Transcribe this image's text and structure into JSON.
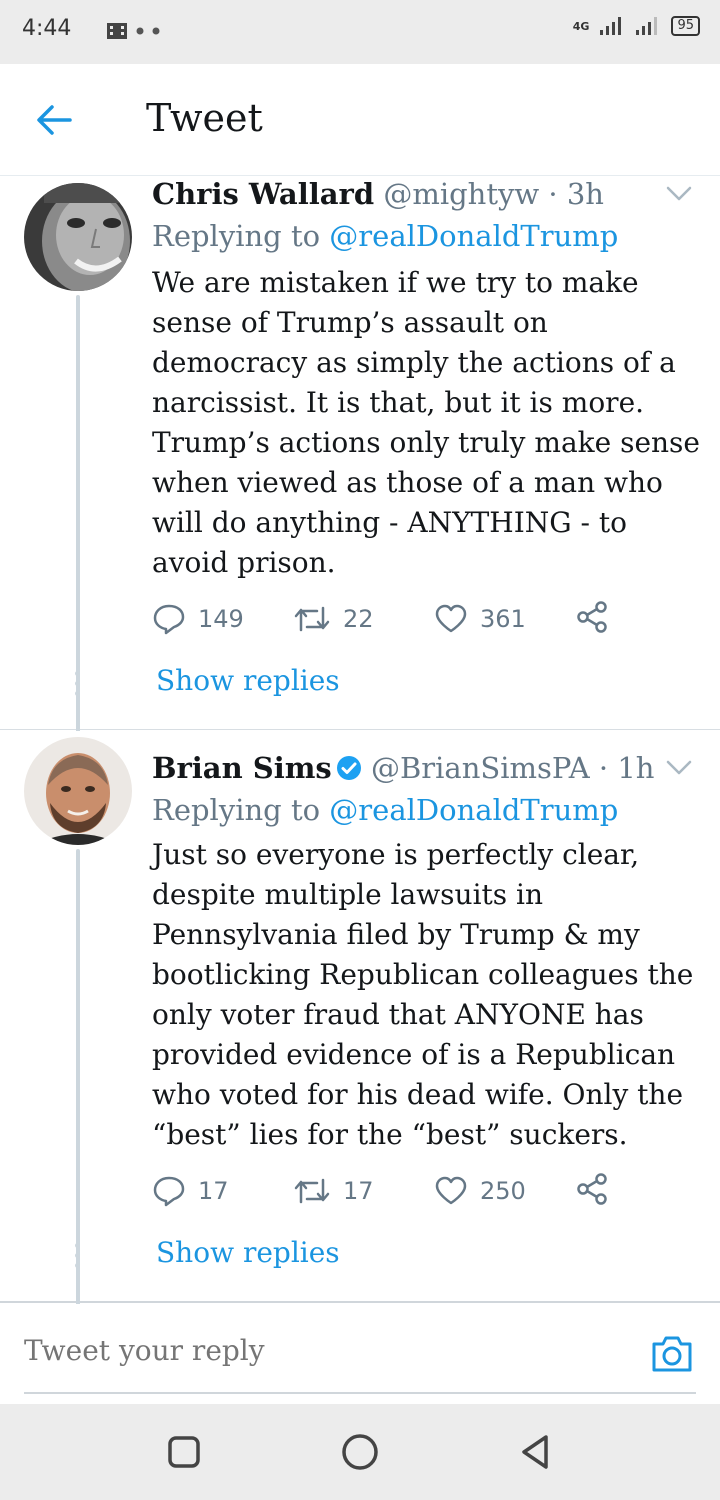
{
  "status_bar": {
    "time": "4:44",
    "network": "4G",
    "battery": "95"
  },
  "header": {
    "title": "Tweet"
  },
  "tweets": [
    {
      "author": "Chris Wallard",
      "handle": "@mightyw",
      "separator": "·",
      "time": "3h",
      "verified": false,
      "reply_label": "Replying to",
      "reply_to": "@realDonaldTrump",
      "text": "We are mistaken if we try to make sense of Trump’s assault on democracy as simply the actions of a narcissist. It is that, but it is more. Trump’s actions only truly make sense when viewed as those of a man who will do anything - ANYTHING - to avoid prison.",
      "replies": "149",
      "retweets": "22",
      "likes": "361",
      "show_replies": "Show replies"
    },
    {
      "author": "Brian Sims",
      "handle": "@BrianSimsPA",
      "separator": "·",
      "time": "1h",
      "verified": true,
      "reply_label": "Replying to",
      "reply_to": "@realDonaldTrump",
      "text": "Just so everyone is perfectly clear, despite multiple lawsuits in Pennsylvania filed by Trump & my bootlicking Republican colleagues the only voter fraud that ANYONE has provided evidence of is a Republican who voted for his dead wife. Only the “best” lies for the “best” suckers.",
      "replies": "17",
      "retweets": "17",
      "likes": "250",
      "show_replies": "Show replies"
    }
  ],
  "reply_bar": {
    "placeholder": "Tweet your reply"
  },
  "colors": {
    "link": "#1b95e0",
    "muted": "#657786",
    "text": "#14171a"
  }
}
